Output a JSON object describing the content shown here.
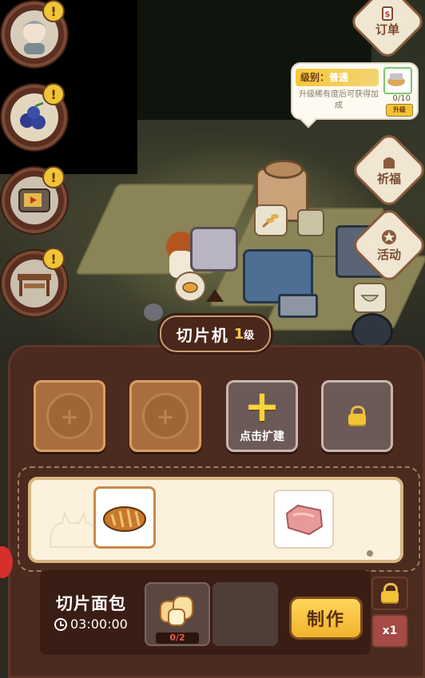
{
  "side_buttons": [
    {
      "name": "avatar",
      "alert": "!"
    },
    {
      "name": "blueberry",
      "alert": "!"
    },
    {
      "name": "tv",
      "alert": "!"
    },
    {
      "name": "stall",
      "alert": "!"
    }
  ],
  "right_menu": {
    "orders_label": "订单",
    "bless_label": "祈福",
    "events_label": "活动"
  },
  "tooltip": {
    "level_prefix": "级别：",
    "level_value": "普通",
    "description": "升级稀有度后可获得加成",
    "count": "0/10",
    "upgrade_label": "升级"
  },
  "machine": {
    "name": "切片机",
    "level_number": "1",
    "level_unit": "级"
  },
  "slots": {
    "expand_label": "点击扩建"
  },
  "recipe": {
    "name": "切片面包",
    "time": "03:00:00",
    "ingredient_count": "0/2",
    "craft_label": "制作",
    "multiplier": "x1"
  },
  "colors": {
    "panel_bg": "#4b2a1f",
    "gold": "#f2c335",
    "cream": "#fbf1dd"
  }
}
